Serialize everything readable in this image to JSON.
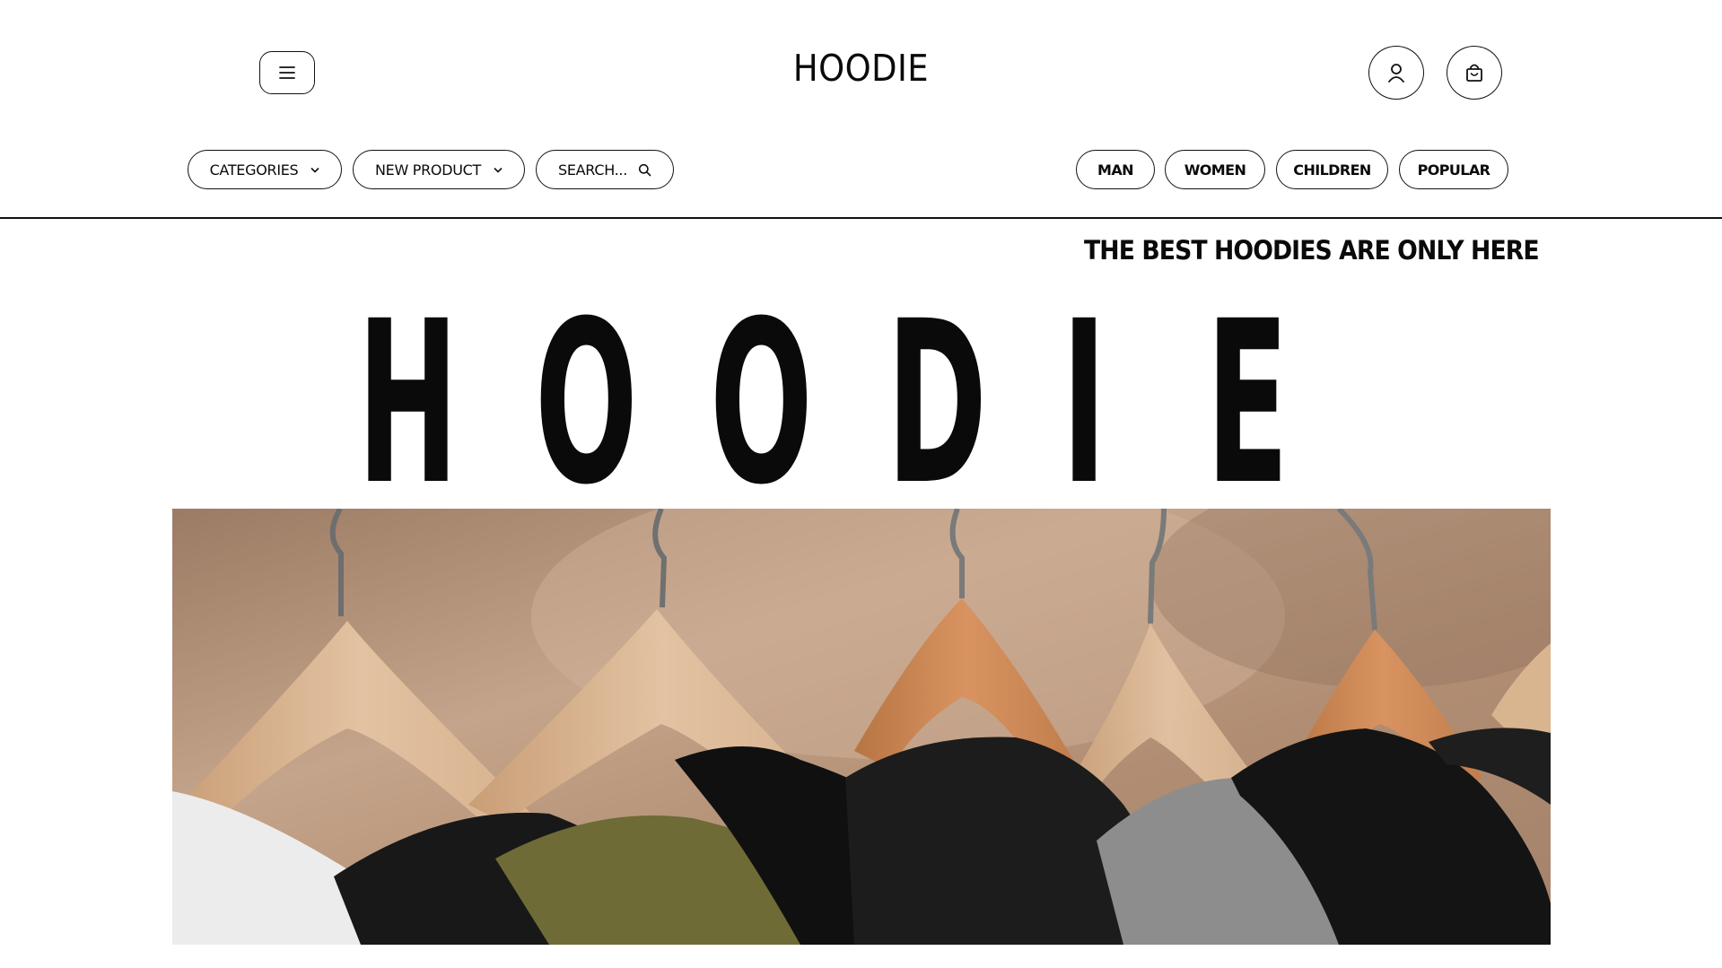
{
  "header": {
    "logo": "HOODIE",
    "menu_icon": "hamburger-menu-icon",
    "account_icon": "user-icon",
    "cart_icon": "shopping-bag-icon"
  },
  "nav_left": {
    "categories": "CATEGORIES",
    "new_product": "NEW PRODUCT",
    "search_placeholder": "SEARCH..."
  },
  "nav_right": {
    "items": [
      "MAN",
      "WOMEN",
      "CHILDREN",
      "POPULAR"
    ]
  },
  "hero": {
    "tagline": "THE BEST HOODIES ARE ONLY HERE",
    "word_letters": [
      "H",
      "O",
      "O",
      "D",
      "I",
      "E"
    ],
    "image_alt": "Hoodies hanging on wooden hangers"
  },
  "colors": {
    "text": "#0a0a0a",
    "background": "#ffffff",
    "border": "#111111"
  }
}
